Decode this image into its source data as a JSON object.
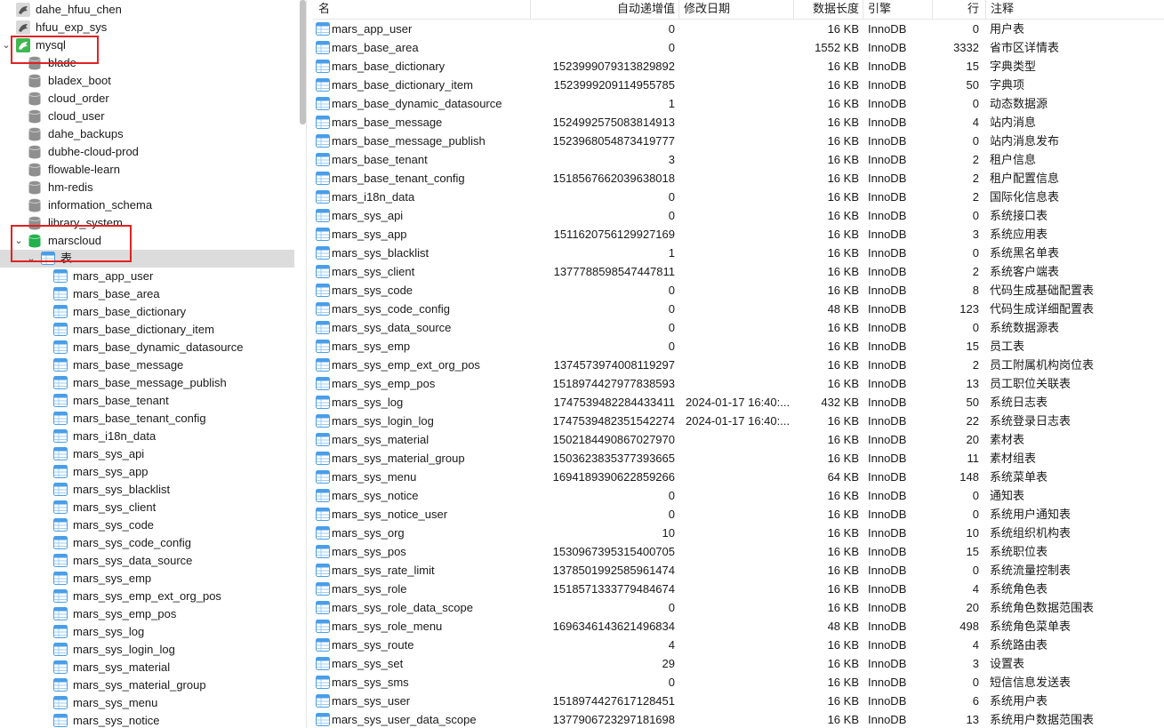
{
  "sidebar": {
    "connections": [
      {
        "label": "dahe_hfuu_chen",
        "kind": "conn"
      },
      {
        "label": "hfuu_exp_sys",
        "kind": "conn"
      },
      {
        "label": "mysql",
        "kind": "mysql"
      }
    ],
    "databases": [
      "blade",
      "bladex_boot",
      "cloud_order",
      "cloud_user",
      "dahe_backups",
      "dubhe-cloud-prod",
      "flowable-learn",
      "hm-redis",
      "information_schema",
      "library_system"
    ],
    "active_db": "marscloud",
    "table_group": "表",
    "tables": [
      "mars_app_user",
      "mars_base_area",
      "mars_base_dictionary",
      "mars_base_dictionary_item",
      "mars_base_dynamic_datasource",
      "mars_base_message",
      "mars_base_message_publish",
      "mars_base_tenant",
      "mars_base_tenant_config",
      "mars_i18n_data",
      "mars_sys_api",
      "mars_sys_app",
      "mars_sys_blacklist",
      "mars_sys_client",
      "mars_sys_code",
      "mars_sys_code_config",
      "mars_sys_data_source",
      "mars_sys_emp",
      "mars_sys_emp_ext_org_pos",
      "mars_sys_emp_pos",
      "mars_sys_log",
      "mars_sys_login_log",
      "mars_sys_material",
      "mars_sys_material_group",
      "mars_sys_menu",
      "mars_sys_notice"
    ]
  },
  "columns": {
    "name": "名",
    "auto_inc": "自动递增值",
    "modified": "修改日期",
    "data_length": "数据长度",
    "engine": "引擎",
    "rows": "行",
    "comment": "注释"
  },
  "rows": [
    {
      "name": "mars_app_user",
      "auto": "0",
      "date": "",
      "len": "16 KB",
      "engine": "InnoDB",
      "rows": "0",
      "comment": "用户表"
    },
    {
      "name": "mars_base_area",
      "auto": "0",
      "date": "",
      "len": "1552 KB",
      "engine": "InnoDB",
      "rows": "3332",
      "comment": "省市区详情表"
    },
    {
      "name": "mars_base_dictionary",
      "auto": "1523999079313829892",
      "date": "",
      "len": "16 KB",
      "engine": "InnoDB",
      "rows": "15",
      "comment": "字典类型"
    },
    {
      "name": "mars_base_dictionary_item",
      "auto": "1523999209114955785",
      "date": "",
      "len": "16 KB",
      "engine": "InnoDB",
      "rows": "50",
      "comment": "字典项"
    },
    {
      "name": "mars_base_dynamic_datasource",
      "auto": "1",
      "date": "",
      "len": "16 KB",
      "engine": "InnoDB",
      "rows": "0",
      "comment": "动态数据源"
    },
    {
      "name": "mars_base_message",
      "auto": "1524992575083814913",
      "date": "",
      "len": "16 KB",
      "engine": "InnoDB",
      "rows": "4",
      "comment": "站内消息"
    },
    {
      "name": "mars_base_message_publish",
      "auto": "1523968054873419777",
      "date": "",
      "len": "16 KB",
      "engine": "InnoDB",
      "rows": "0",
      "comment": "站内消息发布"
    },
    {
      "name": "mars_base_tenant",
      "auto": "3",
      "date": "",
      "len": "16 KB",
      "engine": "InnoDB",
      "rows": "2",
      "comment": "租户信息"
    },
    {
      "name": "mars_base_tenant_config",
      "auto": "1518567662039638018",
      "date": "",
      "len": "16 KB",
      "engine": "InnoDB",
      "rows": "2",
      "comment": "租户配置信息"
    },
    {
      "name": "mars_i18n_data",
      "auto": "0",
      "date": "",
      "len": "16 KB",
      "engine": "InnoDB",
      "rows": "2",
      "comment": "国际化信息表"
    },
    {
      "name": "mars_sys_api",
      "auto": "0",
      "date": "",
      "len": "16 KB",
      "engine": "InnoDB",
      "rows": "0",
      "comment": "系统接口表"
    },
    {
      "name": "mars_sys_app",
      "auto": "1511620756129927169",
      "date": "",
      "len": "16 KB",
      "engine": "InnoDB",
      "rows": "3",
      "comment": "系统应用表"
    },
    {
      "name": "mars_sys_blacklist",
      "auto": "1",
      "date": "",
      "len": "16 KB",
      "engine": "InnoDB",
      "rows": "0",
      "comment": "系统黑名单表"
    },
    {
      "name": "mars_sys_client",
      "auto": "1377788598547447811",
      "date": "",
      "len": "16 KB",
      "engine": "InnoDB",
      "rows": "2",
      "comment": "系统客户端表"
    },
    {
      "name": "mars_sys_code",
      "auto": "0",
      "date": "",
      "len": "16 KB",
      "engine": "InnoDB",
      "rows": "8",
      "comment": "代码生成基础配置表"
    },
    {
      "name": "mars_sys_code_config",
      "auto": "0",
      "date": "",
      "len": "48 KB",
      "engine": "InnoDB",
      "rows": "123",
      "comment": "代码生成详细配置表"
    },
    {
      "name": "mars_sys_data_source",
      "auto": "0",
      "date": "",
      "len": "16 KB",
      "engine": "InnoDB",
      "rows": "0",
      "comment": "系统数据源表"
    },
    {
      "name": "mars_sys_emp",
      "auto": "0",
      "date": "",
      "len": "16 KB",
      "engine": "InnoDB",
      "rows": "15",
      "comment": "员工表"
    },
    {
      "name": "mars_sys_emp_ext_org_pos",
      "auto": "1374573974008119297",
      "date": "",
      "len": "16 KB",
      "engine": "InnoDB",
      "rows": "2",
      "comment": "员工附属机构岗位表"
    },
    {
      "name": "mars_sys_emp_pos",
      "auto": "1518974427977838593",
      "date": "",
      "len": "16 KB",
      "engine": "InnoDB",
      "rows": "13",
      "comment": "员工职位关联表"
    },
    {
      "name": "mars_sys_log",
      "auto": "1747539482284433411",
      "date": "2024-01-17 16:40:...",
      "len": "432 KB",
      "engine": "InnoDB",
      "rows": "50",
      "comment": "系统日志表"
    },
    {
      "name": "mars_sys_login_log",
      "auto": "1747539482351542274",
      "date": "2024-01-17 16:40:...",
      "len": "16 KB",
      "engine": "InnoDB",
      "rows": "22",
      "comment": "系统登录日志表"
    },
    {
      "name": "mars_sys_material",
      "auto": "1502184490867027970",
      "date": "",
      "len": "16 KB",
      "engine": "InnoDB",
      "rows": "20",
      "comment": "素材表"
    },
    {
      "name": "mars_sys_material_group",
      "auto": "1503623835377393665",
      "date": "",
      "len": "16 KB",
      "engine": "InnoDB",
      "rows": "11",
      "comment": "素材组表"
    },
    {
      "name": "mars_sys_menu",
      "auto": "1694189390622859266",
      "date": "",
      "len": "64 KB",
      "engine": "InnoDB",
      "rows": "148",
      "comment": "系统菜单表"
    },
    {
      "name": "mars_sys_notice",
      "auto": "0",
      "date": "",
      "len": "16 KB",
      "engine": "InnoDB",
      "rows": "0",
      "comment": "通知表"
    },
    {
      "name": "mars_sys_notice_user",
      "auto": "0",
      "date": "",
      "len": "16 KB",
      "engine": "InnoDB",
      "rows": "0",
      "comment": "系统用户通知表"
    },
    {
      "name": "mars_sys_org",
      "auto": "10",
      "date": "",
      "len": "16 KB",
      "engine": "InnoDB",
      "rows": "10",
      "comment": "系统组织机构表"
    },
    {
      "name": "mars_sys_pos",
      "auto": "1530967395315400705",
      "date": "",
      "len": "16 KB",
      "engine": "InnoDB",
      "rows": "15",
      "comment": "系统职位表"
    },
    {
      "name": "mars_sys_rate_limit",
      "auto": "1378501992585961474",
      "date": "",
      "len": "16 KB",
      "engine": "InnoDB",
      "rows": "0",
      "comment": "系统流量控制表"
    },
    {
      "name": "mars_sys_role",
      "auto": "1518571333779484674",
      "date": "",
      "len": "16 KB",
      "engine": "InnoDB",
      "rows": "4",
      "comment": "系统角色表"
    },
    {
      "name": "mars_sys_role_data_scope",
      "auto": "0",
      "date": "",
      "len": "16 KB",
      "engine": "InnoDB",
      "rows": "20",
      "comment": "系统角色数据范围表"
    },
    {
      "name": "mars_sys_role_menu",
      "auto": "1696346143621496834",
      "date": "",
      "len": "48 KB",
      "engine": "InnoDB",
      "rows": "498",
      "comment": "系统角色菜单表"
    },
    {
      "name": "mars_sys_route",
      "auto": "4",
      "date": "",
      "len": "16 KB",
      "engine": "InnoDB",
      "rows": "4",
      "comment": "系统路由表"
    },
    {
      "name": "mars_sys_set",
      "auto": "29",
      "date": "",
      "len": "16 KB",
      "engine": "InnoDB",
      "rows": "3",
      "comment": "设置表"
    },
    {
      "name": "mars_sys_sms",
      "auto": "0",
      "date": "",
      "len": "16 KB",
      "engine": "InnoDB",
      "rows": "0",
      "comment": "短信信息发送表"
    },
    {
      "name": "mars_sys_user",
      "auto": "1518974427617128451",
      "date": "",
      "len": "16 KB",
      "engine": "InnoDB",
      "rows": "6",
      "comment": "系统用户表"
    },
    {
      "name": "mars_sys_user_data_scope",
      "auto": "1377906723297181698",
      "date": "",
      "len": "16 KB",
      "engine": "InnoDB",
      "rows": "13",
      "comment": "系统用户数据范围表"
    }
  ],
  "colors": {
    "highlight_box": "#e02222",
    "table_icon": "#4a9ee8",
    "mysql_icon": "#3fb850",
    "selected_row": "#dcdcdc"
  }
}
